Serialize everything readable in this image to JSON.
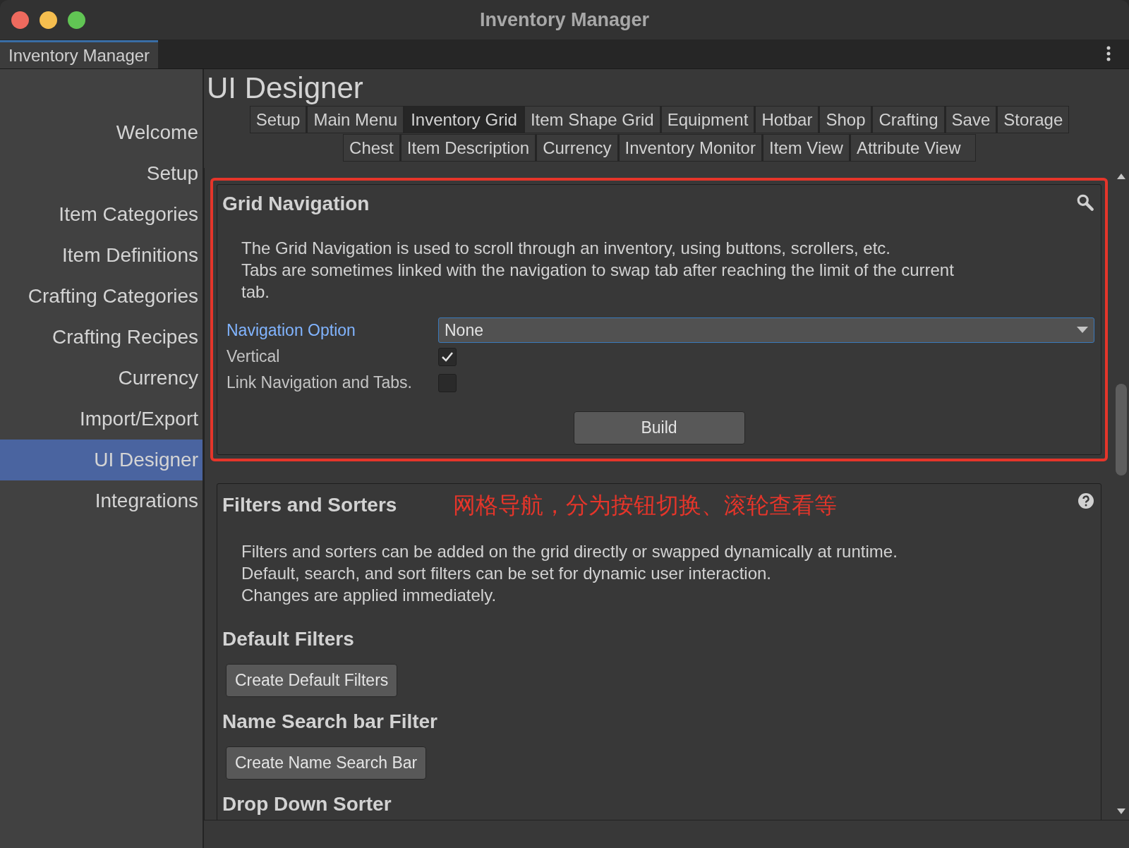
{
  "window": {
    "title": "Inventory Manager"
  },
  "dock_tab": {
    "label": "Inventory Manager",
    "selected": true
  },
  "sidebar": {
    "items": [
      {
        "label": "Welcome",
        "selected": false
      },
      {
        "label": "Setup",
        "selected": false
      },
      {
        "label": "Item Categories",
        "selected": false
      },
      {
        "label": "Item Definitions",
        "selected": false
      },
      {
        "label": "Crafting Categories",
        "selected": false
      },
      {
        "label": "Crafting Recipes",
        "selected": false
      },
      {
        "label": "Currency",
        "selected": false
      },
      {
        "label": "Import/Export",
        "selected": false
      },
      {
        "label": "UI Designer",
        "selected": true
      },
      {
        "label": "Integrations",
        "selected": false
      }
    ]
  },
  "page_title": "UI Designer",
  "tab_rows": [
    [
      {
        "label": "Setup",
        "selected": false
      },
      {
        "label": "Main Menu",
        "selected": false
      },
      {
        "label": "Inventory Grid",
        "selected": true
      },
      {
        "label": "Item Shape Grid",
        "selected": false
      },
      {
        "label": "Equipment",
        "selected": false
      },
      {
        "label": "Hotbar",
        "selected": false
      },
      {
        "label": "Shop",
        "selected": false
      },
      {
        "label": "Crafting",
        "selected": false
      },
      {
        "label": "Save",
        "selected": false
      },
      {
        "label": "Storage",
        "selected": false
      }
    ],
    [
      {
        "label": "Chest",
        "selected": false
      },
      {
        "label": "Item Description",
        "selected": false
      },
      {
        "label": "Currency",
        "selected": false
      },
      {
        "label": "Inventory Monitor",
        "selected": false
      },
      {
        "label": "Item View",
        "selected": false
      },
      {
        "label": "Attribute View",
        "selected": false
      }
    ]
  ],
  "sections": [
    {
      "title": "Grid Navigation",
      "highlighted": true,
      "description": [
        "The Grid Navigation is used to scroll through an inventory, using buttons, scrollers, etc.",
        "Tabs are sometimes linked with the navigation to swap tab after reaching the limit of the current tab."
      ],
      "fields": [
        {
          "kind": "dropdown",
          "label": "Navigation Option",
          "value": "None",
          "focused": true
        },
        {
          "kind": "checkbox",
          "label": "Vertical",
          "checked": true
        },
        {
          "kind": "checkbox",
          "label": "Link Navigation and Tabs.",
          "checked": false
        }
      ],
      "button": "Build"
    },
    {
      "title": "Filters and Sorters",
      "highlighted": false,
      "annotation": "网格导航，分为按钮切换、滚轮查看等",
      "description": [
        "Filters and sorters can be added on the grid directly or swapped dynamically at runtime.",
        "Default, search, and sort filters can be set for dynamic user interaction.",
        "Changes are applied immediately."
      ],
      "subsections": [
        {
          "title": "Default Filters",
          "button": "Create Default Filters"
        },
        {
          "title": "Name Search bar Filter",
          "button": "Create Name Search Bar"
        },
        {
          "title": "Drop Down Sorter"
        }
      ]
    }
  ]
}
